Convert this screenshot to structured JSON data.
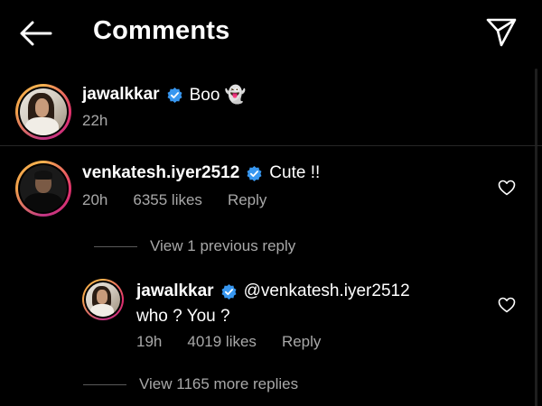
{
  "header": {
    "title": "Comments"
  },
  "comments": [
    {
      "username": "jawalkkar",
      "text": "Boo 👻",
      "time": "22h"
    },
    {
      "username": "venkatesh.iyer2512",
      "text": "Cute !!",
      "time": "20h",
      "likes": "6355 likes",
      "reply_label": "Reply",
      "view_replies": "View 1 previous reply"
    }
  ],
  "reply": {
    "username": "jawalkkar",
    "mention": "@venkatesh.iyer2512",
    "text": "who ? You ?",
    "time": "19h",
    "likes": "4019 likes",
    "reply_label": "Reply",
    "view_more": "View 1165 more replies"
  },
  "colors": {
    "background": "#000000",
    "secondary_text": "#a8a8a8",
    "verified": "#3897f0"
  }
}
